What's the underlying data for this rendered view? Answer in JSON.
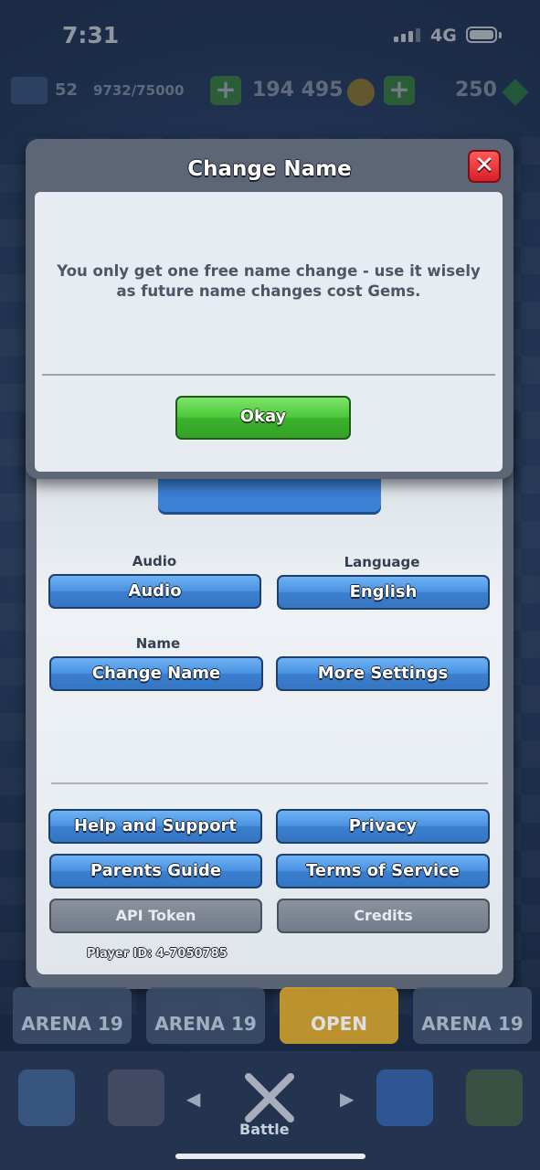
{
  "status_bar": {
    "time": "7:31",
    "network": "4G"
  },
  "resources": {
    "level": "52",
    "xp": "9732/75000",
    "gold": "194 495",
    "gems": "250"
  },
  "dialog": {
    "title": "Change Name",
    "close_icon": "close-icon",
    "message": "You only get one free name change - use it wisely as future name changes cost Gems.",
    "okay_label": "Okay"
  },
  "settings": {
    "audio_label": "Audio",
    "audio_button": "Audio",
    "language_label": "Language",
    "language_button": "English",
    "name_label": "Name",
    "change_name_button": "Change Name",
    "more_settings_button": "More Settings",
    "help_button": "Help and Support",
    "privacy_button": "Privacy",
    "parents_guide_button": "Parents Guide",
    "terms_button": "Terms of Service",
    "api_token_button": "API Token",
    "credits_button": "Credits",
    "player_id": "Player ID: 4-7050785"
  },
  "arenas": [
    "ARENA 19",
    "ARENA 19",
    "OPEN",
    "ARENA 19"
  ],
  "nav": {
    "battle_label": "Battle"
  },
  "colors": {
    "accent_blue": "#4a93e2",
    "okay_green": "#4cc83a",
    "close_red": "#d81f2a"
  }
}
